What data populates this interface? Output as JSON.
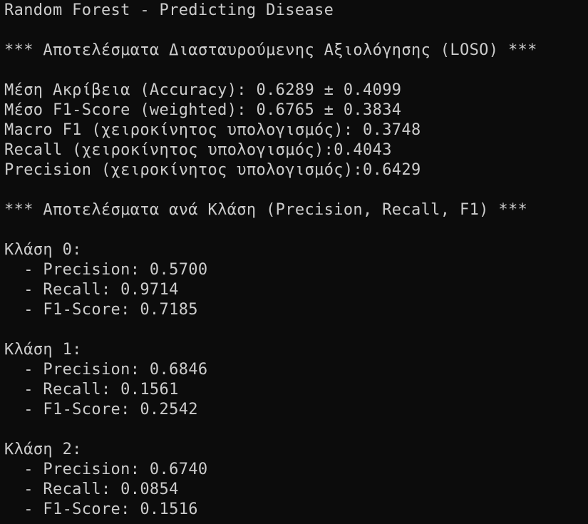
{
  "terminal": {
    "lines": [
      "Random Forest - Predicting Disease",
      "",
      "*** Αποτελέσματα Διασταυρούμενης Αξιολόγησης (LOSO) ***",
      "",
      "Μέση Ακρίβεια (Accuracy): 0.6289 ± 0.4099",
      "Μέσο F1-Score (weighted): 0.6765 ± 0.3834",
      "Macro F1 (χειροκίνητος υπολογισμός): 0.3748",
      "Recall (χειροκίνητος υπολογισμός):0.4043",
      "Precision (χειροκίνητος υπολογισμός):0.6429",
      "",
      "*** Αποτελέσματα ανά Κλάση (Precision, Recall, F1) ***",
      "",
      "Κλάση 0:",
      "  - Precision: 0.5700",
      "  - Recall: 0.9714",
      "  - F1-Score: 0.7185",
      "",
      "Κλάση 1:",
      "  - Precision: 0.6846",
      "  - Recall: 0.1561",
      "  - F1-Score: 0.2542",
      "",
      "Κλάση 2:",
      "  - Precision: 0.6740",
      "  - Recall: 0.0854",
      "  - F1-Score: 0.1516"
    ],
    "colors": {
      "background": "#0c0c0c",
      "foreground": "#cccccc"
    }
  }
}
